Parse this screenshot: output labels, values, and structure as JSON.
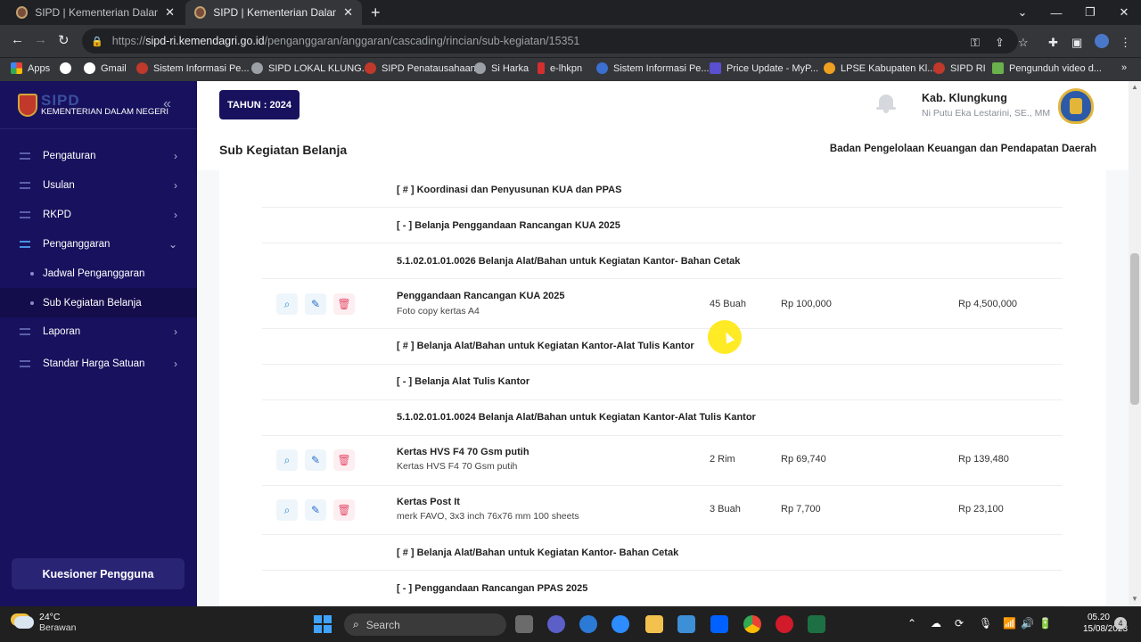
{
  "browser": {
    "tabs": [
      {
        "title": "SIPD | Kementerian Dalam Negeri",
        "active": false
      },
      {
        "title": "SIPD | Kementerian Dalam Negeri",
        "active": true
      }
    ],
    "url_prefix": "https://",
    "url_host": "sipd-ri.kemendagri.go.id",
    "url_path": "/penganggaran/anggaran/cascading/rincian/sub-kegiatan/15351",
    "bookmarks": [
      {
        "label": "Apps",
        "icon": "apps-icon",
        "color": "#ea4335"
      },
      {
        "label": "Gmail",
        "icon": "google-icon",
        "color": "#ffffff"
      },
      {
        "label": "Sistem Informasi Pe...",
        "icon": "sipd-icon",
        "color": "#c0392b"
      },
      {
        "label": "SIPD LOKAL KLUNG...",
        "icon": "globe-icon",
        "color": "#9aa0a6"
      },
      {
        "label": "SIPD Penatausahaan",
        "icon": "sipd-icon",
        "color": "#c0392b"
      },
      {
        "label": "Si Harka",
        "icon": "globe-icon",
        "color": "#9aa0a6"
      },
      {
        "label": "e-lhkpn",
        "icon": "lhkpn-icon",
        "color": "#d32f2f"
      },
      {
        "label": "Sistem Informasi Pe...",
        "icon": "emblem-icon",
        "color": "#3b6fd0"
      },
      {
        "label": "Price Update - MyP...",
        "icon": "myp-icon",
        "color": "#5a4fcf"
      },
      {
        "label": "LPSE Kabupaten Kl...",
        "icon": "lpse-icon",
        "color": "#f0a020"
      },
      {
        "label": "SIPD RI",
        "icon": "sipd-icon",
        "color": "#c0392b"
      },
      {
        "label": "Pengunduh video d...",
        "icon": "download-icon",
        "color": "#6ab04c"
      }
    ]
  },
  "sidebar": {
    "brand": "SIPD",
    "subtitle": "KEMENTERIAN DALAM NEGERI",
    "menu": [
      {
        "label": "Pengaturan"
      },
      {
        "label": "Usulan"
      },
      {
        "label": "RKPD"
      },
      {
        "label": "Penganggaran"
      },
      {
        "label": "Jadwal Penganggaran"
      },
      {
        "label": "Sub Kegiatan Belanja"
      },
      {
        "label": "Laporan"
      },
      {
        "label": "Standar Harga Satuan"
      }
    ],
    "kuesioner": "Kuesioner Pengguna"
  },
  "header": {
    "tahun": "TAHUN : 2024",
    "region": "Kab. Klungkung",
    "user": "Ni Putu Eka Lestarini, SE., MM",
    "page_title": "Sub Kegiatan Belanja",
    "agency": "Badan Pengelolaan Keuangan dan Pendapatan Daerah"
  },
  "rows": [
    {
      "type": "group",
      "text": "[ # ] Koordinasi dan Penyusunan KUA dan PPAS"
    },
    {
      "type": "group",
      "text": "[ - ] Belanja Penggandaan Rancangan KUA 2025"
    },
    {
      "type": "group",
      "text": "5.1.02.01.01.0026 Belanja Alat/Bahan untuk Kegiatan Kantor- Bahan Cetak"
    },
    {
      "type": "item",
      "name": "Penggandaan Rancangan KUA 2025",
      "spec": "Foto copy kertas A4",
      "qty": "45 Buah",
      "price": "Rp 100,000",
      "total": "Rp 4,500,000"
    },
    {
      "type": "group",
      "text": "[ # ] Belanja Alat/Bahan untuk Kegiatan Kantor-Alat Tulis Kantor"
    },
    {
      "type": "group",
      "text": "[ - ] Belanja Alat Tulis Kantor"
    },
    {
      "type": "group",
      "text": "5.1.02.01.01.0024 Belanja Alat/Bahan untuk Kegiatan Kantor-Alat Tulis Kantor"
    },
    {
      "type": "item",
      "name": "Kertas HVS F4 70 Gsm putih",
      "spec": "Kertas HVS F4 70 Gsm putih",
      "qty": "2 Rim",
      "price": "Rp 69,740",
      "total": "Rp 139,480"
    },
    {
      "type": "item",
      "name": "Kertas Post It",
      "spec": "merk FAVO, 3x3 inch 76x76 mm 100 sheets",
      "qty": "3 Buah",
      "price": "Rp 7,700",
      "total": "Rp 23,100"
    },
    {
      "type": "group",
      "text": "[ # ] Belanja Alat/Bahan untuk Kegiatan Kantor- Bahan Cetak"
    },
    {
      "type": "group",
      "text": "[ - ] Penggandaan Rancangan PPAS 2025"
    }
  ],
  "taskbar": {
    "temp": "24°C",
    "weather": "Berawan",
    "search": "Search",
    "time": "05.20",
    "date": "15/08/2023",
    "notifications": "4"
  }
}
